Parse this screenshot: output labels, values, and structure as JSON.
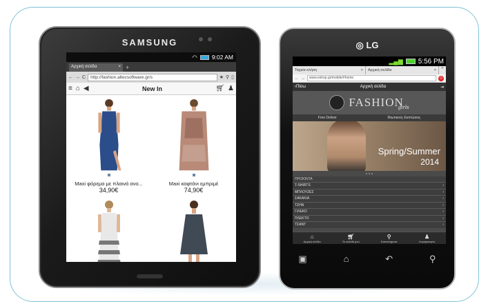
{
  "tablet": {
    "brand": "SAMSUNG",
    "status_time": "9:02 AM",
    "tab_title": "Αρχική σελίδα",
    "url": "http://fashion.altecsoftware.gr/s",
    "nav_title": "New In",
    "products": [
      {
        "name": "Maxi φόρεμα με πλαινά ανο...",
        "price": "34,90€",
        "dress_color": "#2b4d8a"
      },
      {
        "name": "Maxi καφτάνι εμπριμέ",
        "price": "74,90€",
        "dress_color": "#b98a78"
      },
      {
        "name": "",
        "price": "",
        "dress_color": "#e8e8e8"
      },
      {
        "name": "",
        "price": "",
        "dress_color": "#3f4a55"
      }
    ]
  },
  "phone": {
    "brand": "LG",
    "status_time": "5:56 PM",
    "tabs": [
      "Ταχεία κλήση",
      "Αρχική σελίδα"
    ],
    "url": "www.eshop.gr/mobile/#home",
    "header_back": "Πίσω",
    "header_title": "Αρχική σελίδα",
    "logo_word": "FASHION",
    "logo_sub": "girls",
    "categories": [
      "Free Deliver",
      "Ιδιωτικούς Εκπτώσεις"
    ],
    "banner_line1": "Spring/Summer",
    "banner_line2": "2014",
    "section_label": "ΠΡΟΙΟΝΤΑ",
    "menu": [
      "T-SHIRTS",
      "ΜΠΛΟΥΖΕΣ",
      "ΣΑΚΑΚΙΑ",
      "ΤΖΗΝ",
      "ΓΙΛΕΚΟ",
      "ΠΛΕΚΤΟ",
      "ΤΣΑΝΤ"
    ],
    "bottom_nav": [
      "Αρχική σελίδα",
      "Το καλάθι μου",
      "Καταστήματα",
      "Λογαριασμός"
    ]
  }
}
